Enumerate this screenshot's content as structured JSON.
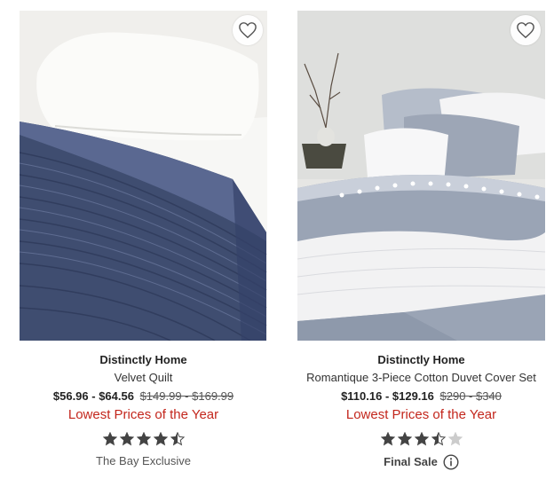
{
  "products": [
    {
      "brand": "Distinctly Home",
      "name": "Velvet Quilt",
      "price_sale": "$56.96 - $64.56",
      "price_original": "$149.99 - $169.99",
      "promo": "Lowest Prices of the Year",
      "rating": 4.5,
      "rating_max": 5,
      "badge": "The Bay Exclusive",
      "icon": "heart-outline"
    },
    {
      "brand": "Distinctly Home",
      "name": "Romantique 3-Piece Cotton Duvet Cover Set",
      "price_sale": "$110.16 - $129.16",
      "price_original": "$290 - $340",
      "promo": "Lowest Prices of the Year",
      "rating": 3.5,
      "rating_max": 5,
      "badge": "Final Sale",
      "badge_icon": "info-icon",
      "icon": "heart-outline"
    }
  ],
  "colors": {
    "promo": "#c3261c",
    "star_filled": "#444444",
    "star_empty": "#cccccc"
  }
}
